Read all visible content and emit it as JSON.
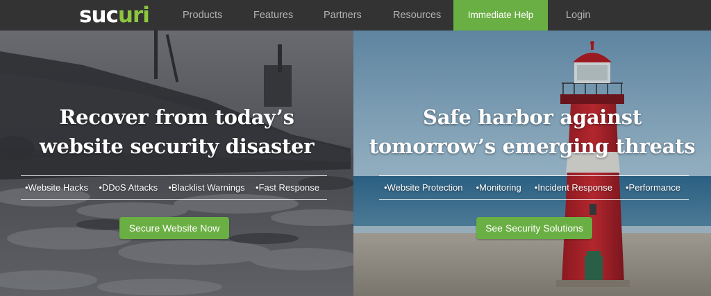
{
  "brand": {
    "logo_main": "suc",
    "logo_accent": "uri",
    "accent_color": "#6aaf43"
  },
  "nav": {
    "items": [
      {
        "label": "Products"
      },
      {
        "label": "Features"
      },
      {
        "label": "Partners"
      },
      {
        "label": "Resources"
      }
    ],
    "help_label": "Immediate Help",
    "login_label": "Login"
  },
  "left_panel": {
    "headline_line1": "Recover from today’s",
    "headline_line2": "website security disaster",
    "bullets": [
      "•Website Hacks",
      "•DDoS Attacks",
      "•Blacklist Warnings",
      "•Fast Response"
    ],
    "cta_label": "Secure Website Now"
  },
  "right_panel": {
    "headline_line1": "Safe harbor against",
    "headline_line2": "tomorrow’s emerging threats",
    "bullets": [
      "•Website Protection",
      "•Monitoring",
      "•Incident Response",
      "•Performance"
    ],
    "cta_label": "See Security Solutions"
  }
}
